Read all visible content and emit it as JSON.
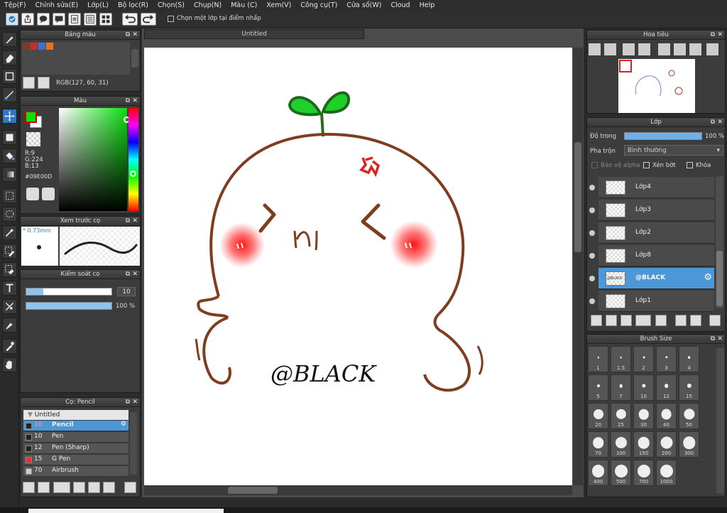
{
  "menu": [
    "Tệp(F)",
    "Chỉnh sửa(E)",
    "Lớp(L)",
    "Bộ lọc(R)",
    "Chọn(S)",
    "Chụp(N)",
    "Màu (C)",
    "Xem(V)",
    "Công cụ(T)",
    "Cửa sổ(W)",
    "Cloud",
    "Help"
  ],
  "toolbar": {
    "sample_checkbox_label": "Chọn một lớp tại điểm nhấp"
  },
  "palette_panel": {
    "title": "Bảng màu",
    "rgb_text": "RGB(127, 60, 31)",
    "swatches": [
      "#7f3c1f",
      "#c03030",
      "#3a6ed8",
      "#f07020"
    ]
  },
  "color_panel": {
    "title": "Màu",
    "r": "R:9",
    "g": "G:224",
    "b": "B:13",
    "hex": "#09E00D",
    "fg": "#09e00d"
  },
  "brush_preview": {
    "title": "Xem trước cọ",
    "size": "* 0.73mm"
  },
  "brush_control": {
    "title": "Kiểm soát cọ",
    "size_value": "10",
    "opacity_value": "100 %"
  },
  "brush_panel": {
    "title": "Cọ: Pencil",
    "group": "Untitled",
    "items": [
      {
        "size": "10",
        "name": "Pencil",
        "color": "#222222"
      },
      {
        "size": "10",
        "name": "Pen",
        "color": "#222222"
      },
      {
        "size": "12",
        "name": "Pen (Sharp)",
        "color": "#222222"
      },
      {
        "size": "15",
        "name": "G Pen",
        "color": "#e03030"
      },
      {
        "size": "70",
        "name": "Airbrush",
        "color": "#cccccc"
      }
    ]
  },
  "document": {
    "tab": "Untitled",
    "canvas_text": "@BLACK"
  },
  "navigator": {
    "title": "Hoa tiêu"
  },
  "layer_panel": {
    "title": "Lớp",
    "opacity_label": "Độ trong",
    "opacity_value": "100 %",
    "blend_label": "Pha trộn",
    "blend_value": "Bình thường",
    "protect_alpha": "Bảo vệ alpha",
    "clipping": "Xén bớt",
    "lock": "Khóa",
    "layers": [
      {
        "name": "Lớp4"
      },
      {
        "name": "Lớp3"
      },
      {
        "name": "Lớp2"
      },
      {
        "name": "Lớp8"
      },
      {
        "name": "@BLACK",
        "thumb_text": "@BLACK"
      },
      {
        "name": "Lớp1"
      }
    ]
  },
  "brush_size_panel": {
    "title": "Brush Size",
    "sizes": [
      "1",
      "1.5",
      "2",
      "3",
      "4",
      "5",
      "7",
      "10",
      "12",
      "15",
      "20",
      "25",
      "30",
      "40",
      "50",
      "70",
      "100",
      "150",
      "200",
      "300",
      "400",
      "500",
      "700",
      "1000"
    ]
  }
}
